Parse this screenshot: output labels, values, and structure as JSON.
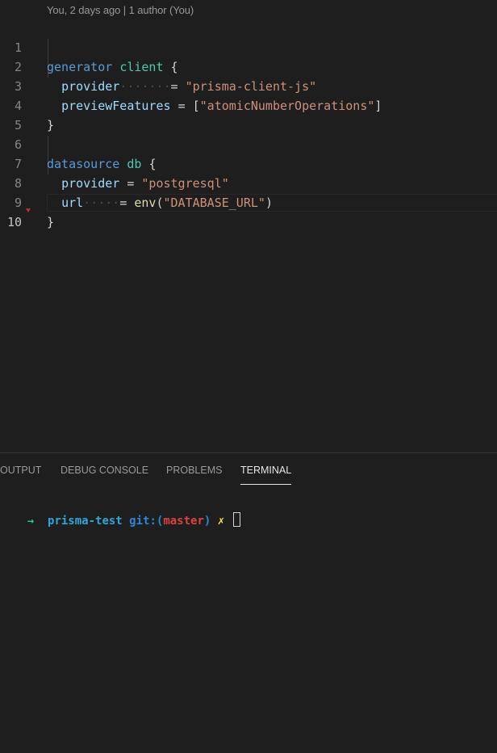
{
  "editor": {
    "codelens": "You, 2 days ago | 1 author (You)",
    "line_numbers": [
      "1",
      "2",
      "3",
      "4",
      "5",
      "6",
      "7",
      "8",
      "9",
      "10"
    ],
    "active_line": "10",
    "generator_block": {
      "keyword": "generator",
      "name": "client",
      "open": "{",
      "close": "}",
      "provider_key": "provider",
      "provider_eq": "=",
      "provider_value": "\"prisma-client-js\"",
      "preview_key": "previewFeatures",
      "preview_eq": "=",
      "preview_open": "[",
      "preview_value": "\"atomicNumberOperations\"",
      "preview_close": "]"
    },
    "datasource_block": {
      "keyword": "datasource",
      "name": "db",
      "open": "{",
      "close": "}",
      "provider_key": "provider",
      "provider_eq": "=",
      "provider_value": "\"postgresql\"",
      "url_key": "url",
      "url_eq": "=",
      "url_fn": "env",
      "url_paren_open": "(",
      "url_arg": "\"DATABASE_URL\"",
      "url_paren_close": ")"
    }
  },
  "panel": {
    "tabs": [
      {
        "label": "OUTPUT",
        "active": false
      },
      {
        "label": "DEBUG CONSOLE",
        "active": false
      },
      {
        "label": "PROBLEMS",
        "active": false
      },
      {
        "label": "TERMINAL",
        "active": true
      }
    ],
    "terminal": {
      "arrow": "→",
      "directory": "prisma-test",
      "git_prefix": "git:(",
      "branch": "master",
      "git_suffix": ")",
      "dirty_mark": "✗"
    }
  },
  "colors": {
    "background": "#1e1e1e",
    "keyword": "#569cd6",
    "type": "#4ec9b0",
    "property": "#9cdcfe",
    "string": "#ce9178",
    "function": "#dcdcaa",
    "terminal_arrow": "#2bc37f",
    "terminal_dir": "#2aa7d8",
    "terminal_branch": "#e0403c",
    "terminal_dirty": "#f3e54c"
  }
}
